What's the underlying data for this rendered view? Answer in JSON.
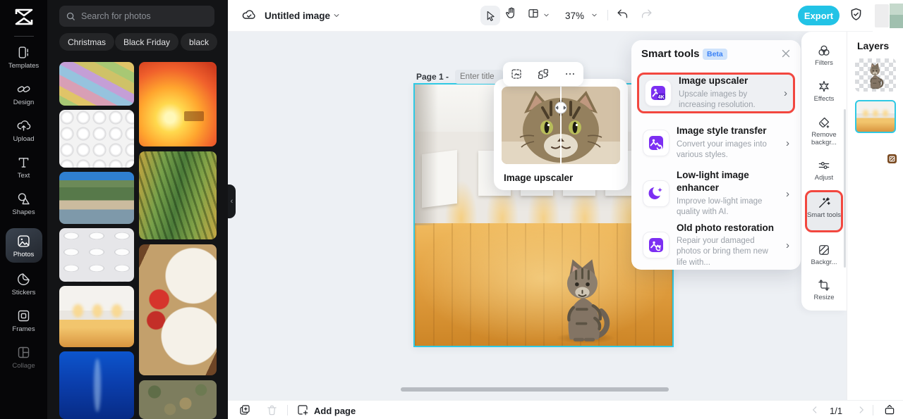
{
  "app": {
    "title": "Untitled image",
    "zoom_level": "37%",
    "export_label": "Export"
  },
  "left_rail": {
    "items": [
      {
        "label": "Templates"
      },
      {
        "label": "Design"
      },
      {
        "label": "Upload"
      },
      {
        "label": "Text"
      },
      {
        "label": "Shapes"
      },
      {
        "label": "Photos"
      },
      {
        "label": "Stickers"
      },
      {
        "label": "Frames"
      },
      {
        "label": "Collage"
      }
    ]
  },
  "photos_panel": {
    "search_placeholder": "Search for photos",
    "tags": [
      {
        "label": "Christmas"
      },
      {
        "label": "Black Friday"
      },
      {
        "label": "black"
      }
    ]
  },
  "canvas": {
    "page_label": "Page 1 -",
    "title_placeholder": "Enter title",
    "tooltip_label": "Image upscaler"
  },
  "smart_tools": {
    "title": "Smart tools",
    "badge": "Beta",
    "items": [
      {
        "title": "Image upscaler",
        "desc": "Upscale images by increasing resolution."
      },
      {
        "title": "Image style transfer",
        "desc": "Convert your images into various styles."
      },
      {
        "title": "Low-light image enhancer",
        "desc": "Improve low-light image quality with AI."
      },
      {
        "title": "Old photo restoration",
        "desc": "Repair your damaged photos or bring them new life with..."
      }
    ],
    "chevron": "›"
  },
  "right_rail": {
    "items": [
      {
        "label": "Filters"
      },
      {
        "label": "Effects"
      },
      {
        "label": "Remove backgr..."
      },
      {
        "label": "Adjust"
      },
      {
        "label": "Smart tools"
      },
      {
        "label": "Backgr..."
      },
      {
        "label": "Resize"
      }
    ]
  },
  "layers_panel": {
    "title": "Layers"
  },
  "bottom_bar": {
    "add_page_label": "Add page",
    "page_indicator": "1/1"
  },
  "colors": {
    "accent_cyan": "#22c3e6",
    "highlight_red": "#f2473f",
    "tool_purple": "#7c2ff2",
    "beta_badge_bg": "#cfe3fb",
    "beta_badge_text": "#3b82f6"
  }
}
